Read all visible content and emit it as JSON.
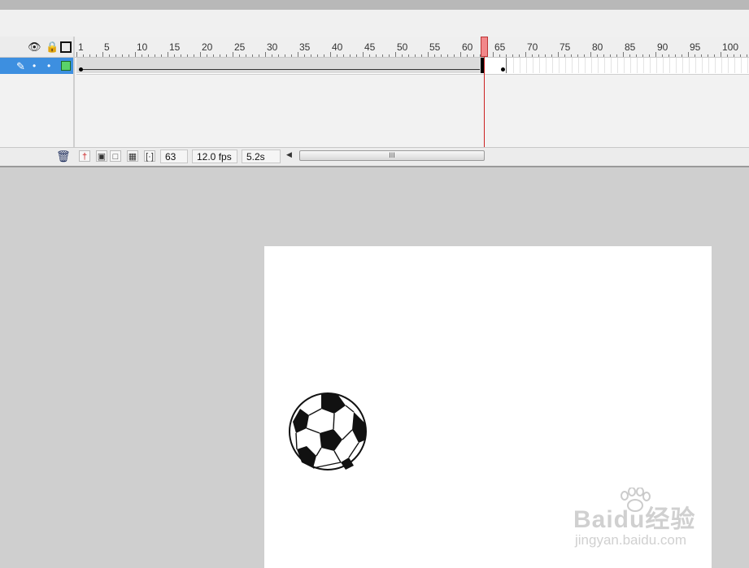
{
  "timeline": {
    "ruler_labels": [
      "1",
      "5",
      "10",
      "15",
      "20",
      "25",
      "30",
      "35",
      "40",
      "45",
      "50",
      "55",
      "60",
      "65",
      "70",
      "75",
      "80",
      "85",
      "90",
      "95",
      "100"
    ],
    "current_frame": "63",
    "frame_rate": "12.0 fps",
    "elapsed_time": "5.2s",
    "scroll_grip": "III"
  },
  "layer_panel": {
    "eye_icon": "eye-icon",
    "lock_icon": "lock-icon",
    "outline_icon": "outline-icon"
  },
  "watermark": {
    "logo_text": "Baidu经验",
    "url_text": "jingyan.baidu.com"
  },
  "colors": {
    "layer_selected": "#3d8fe0",
    "playhead": "#f2878a",
    "stage": "#ffffff"
  }
}
